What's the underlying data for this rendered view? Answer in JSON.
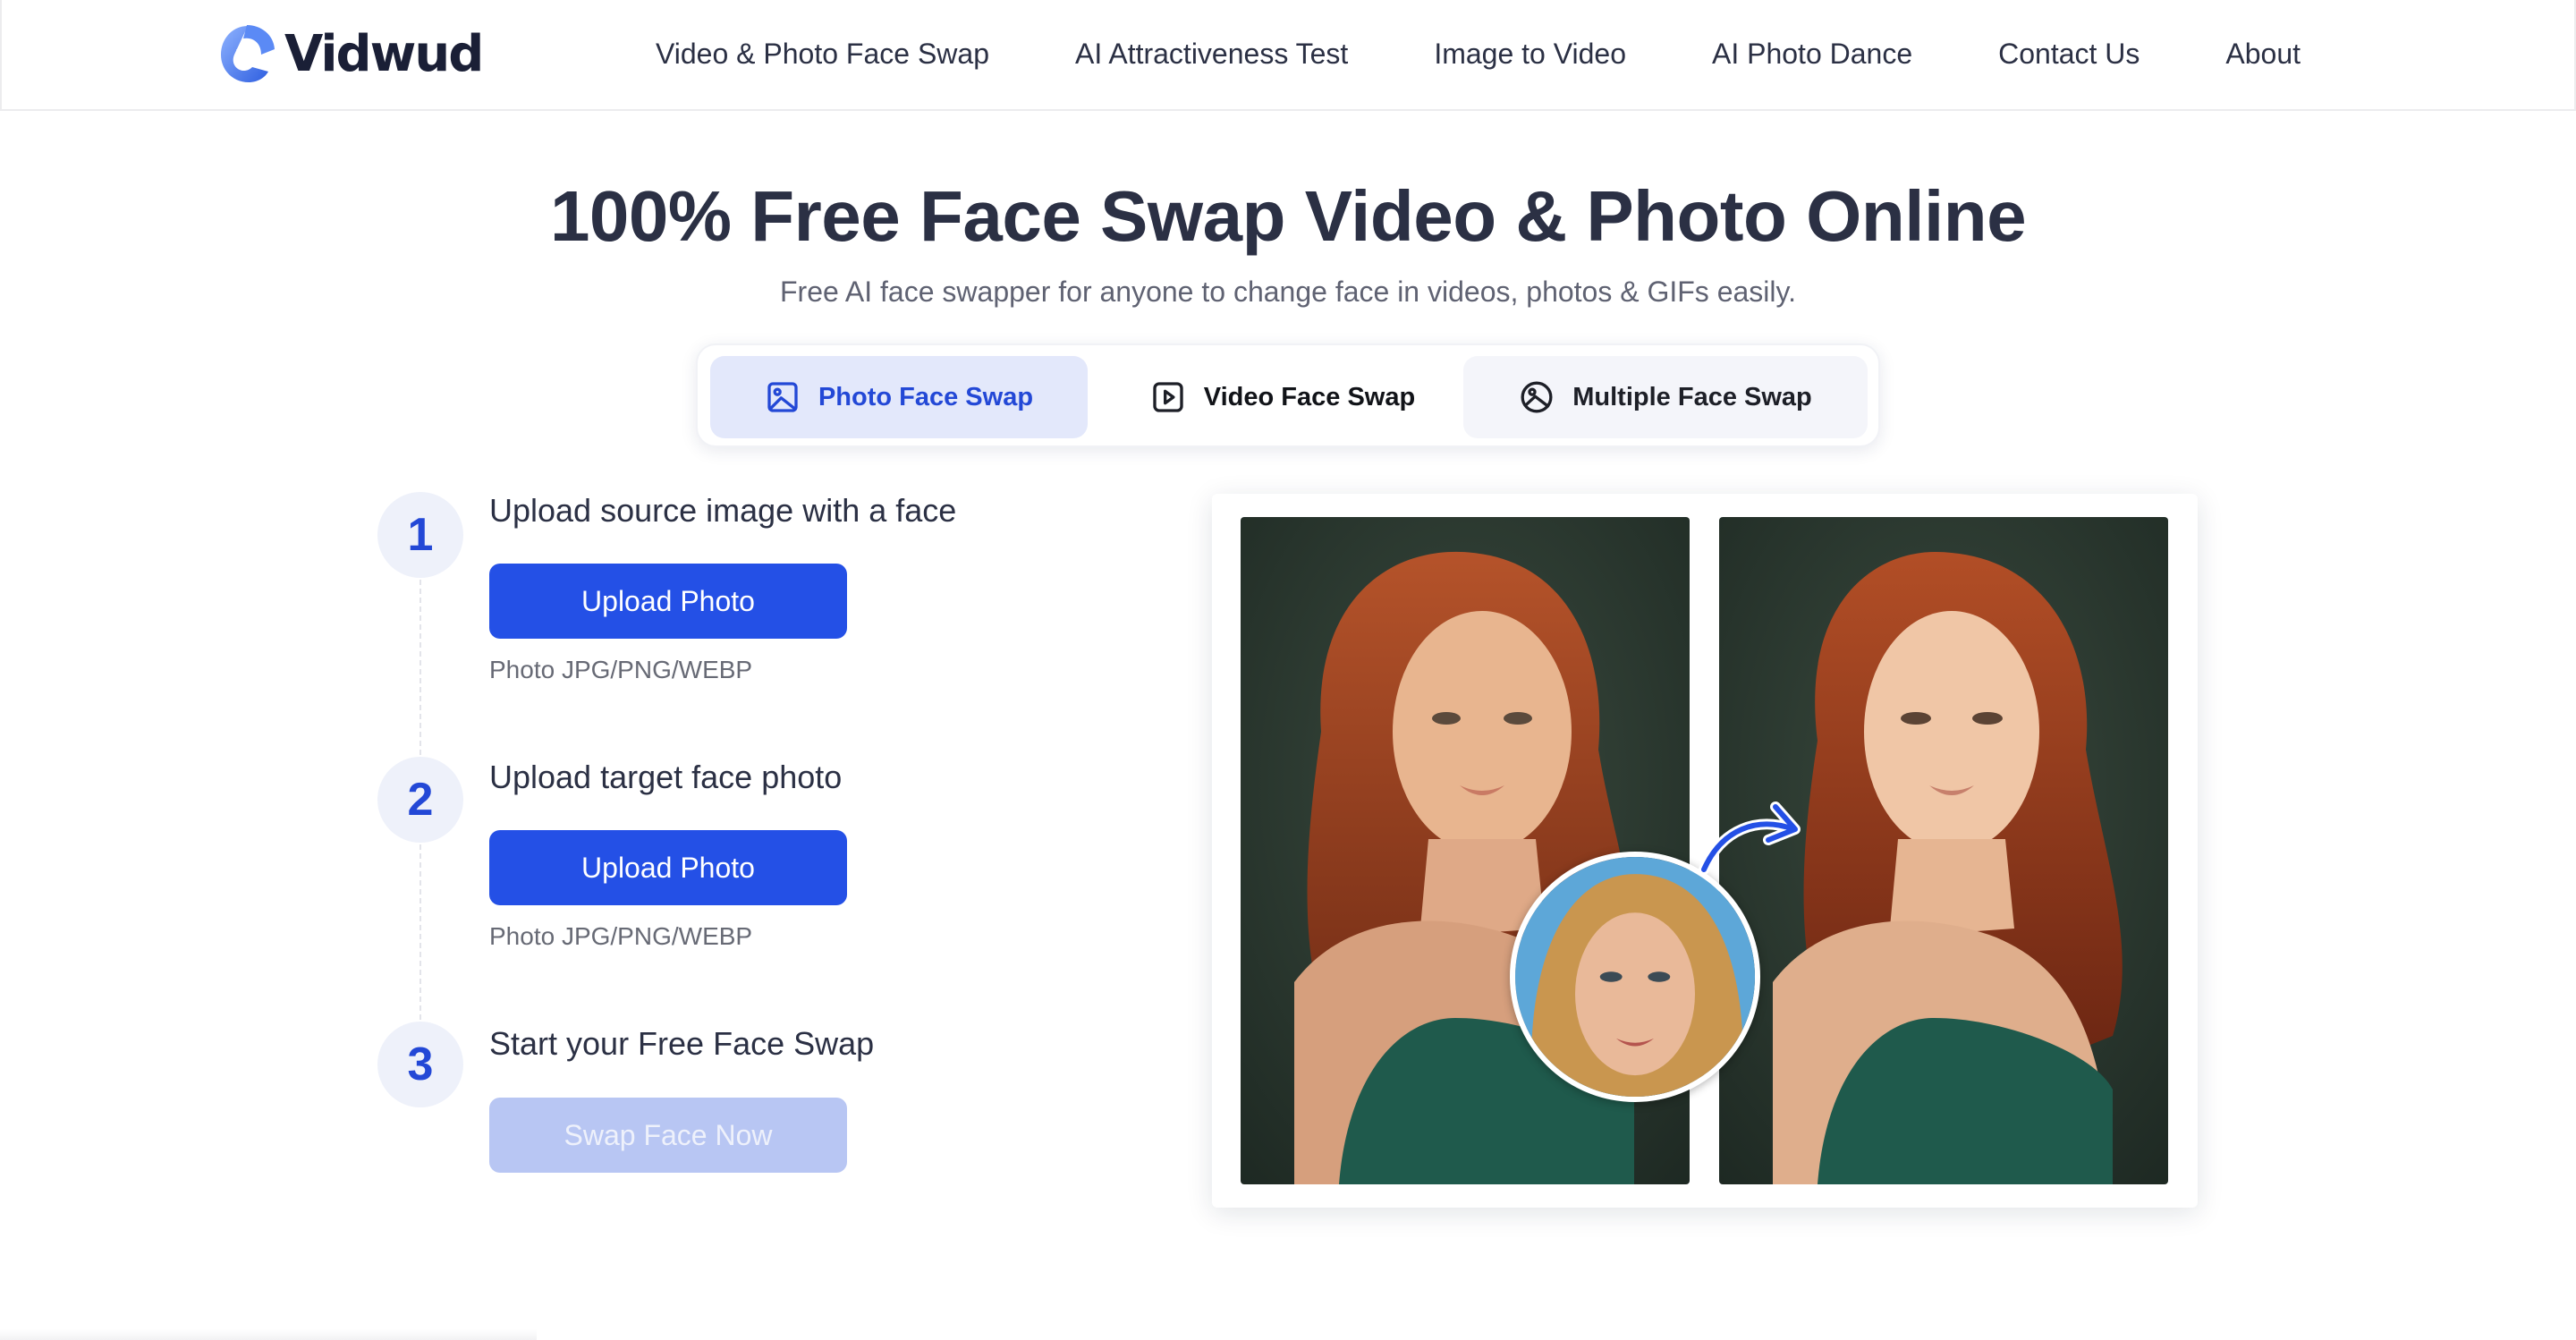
{
  "brand": {
    "name": "Vidwud",
    "accent": "#2450e6",
    "accent_light": "#e3e8fb"
  },
  "nav": {
    "items": [
      {
        "label": "Video & Photo Face Swap"
      },
      {
        "label": "AI Attractiveness Test"
      },
      {
        "label": "Image to Video"
      },
      {
        "label": "AI Photo Dance"
      },
      {
        "label": "Contact Us"
      },
      {
        "label": "About"
      }
    ]
  },
  "hero": {
    "title": "100% Free Face Swap Video & Photo Online",
    "subtitle": "Free AI face swapper for anyone to change face in videos, photos & GIFs easily."
  },
  "tabs": [
    {
      "label": "Photo Face Swap",
      "icon": "image-icon",
      "active": true
    },
    {
      "label": "Video Face Swap",
      "icon": "play-icon",
      "active": false
    },
    {
      "label": "Multiple Face Swap",
      "icon": "circle-image-icon",
      "active": false
    }
  ],
  "steps": [
    {
      "number": "1",
      "title": "Upload source image with a face",
      "button": "Upload Photo",
      "hint": "Photo JPG/PNG/WEBP"
    },
    {
      "number": "2",
      "title": "Upload target face photo",
      "button": "Upload Photo",
      "hint": "Photo JPG/PNG/WEBP"
    },
    {
      "number": "3",
      "title": "Start your Free Face Swap",
      "button": "Swap Face Now",
      "disabled": true
    }
  ],
  "showcase": {
    "before_alt": "Original photo of red-haired woman",
    "face_alt": "Blonde woman face",
    "after_alt": "Face-swapped result"
  }
}
